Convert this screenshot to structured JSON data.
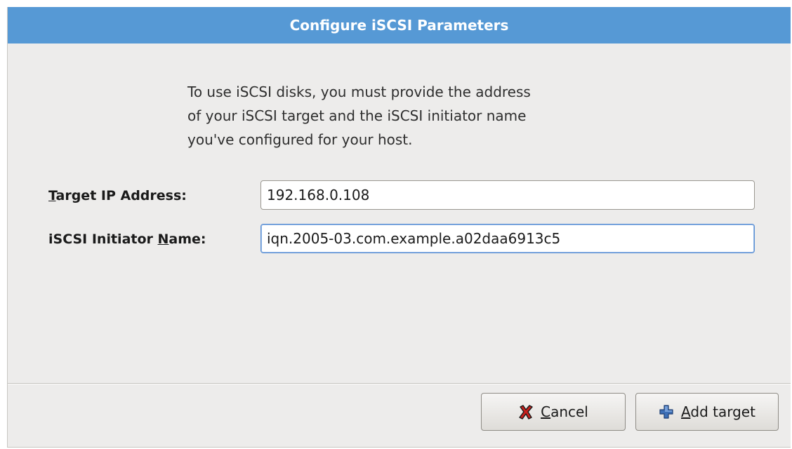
{
  "dialog": {
    "title": "Configure iSCSI Parameters",
    "intro_lines": [
      "To use iSCSI disks, you must provide the address",
      "of your iSCSI target and the iSCSI initiator name",
      "you've configured for your host."
    ]
  },
  "form": {
    "target_ip": {
      "label_mnemonic": "T",
      "label_rest": "arget IP Address:",
      "value": "192.168.0.108"
    },
    "initiator_name": {
      "label_prefix": "iSCSI Initiator ",
      "label_mnemonic": "N",
      "label_rest": "ame:",
      "value": "iqn.2005-03.com.example.a02daa6913c5"
    }
  },
  "buttons": {
    "cancel": {
      "mnemonic": "C",
      "label_rest": "ancel",
      "icon": "cancel-x-icon"
    },
    "add_target": {
      "mnemonic": "A",
      "label_rest": "dd target",
      "icon": "plus-icon"
    }
  },
  "colors": {
    "title_bar": "#5699d5",
    "dialog_bg": "#edeceb",
    "focus_border": "#5b8fd3",
    "cancel_icon_red": "#c8201c",
    "plus_icon_blue": "#3d6fb6"
  }
}
